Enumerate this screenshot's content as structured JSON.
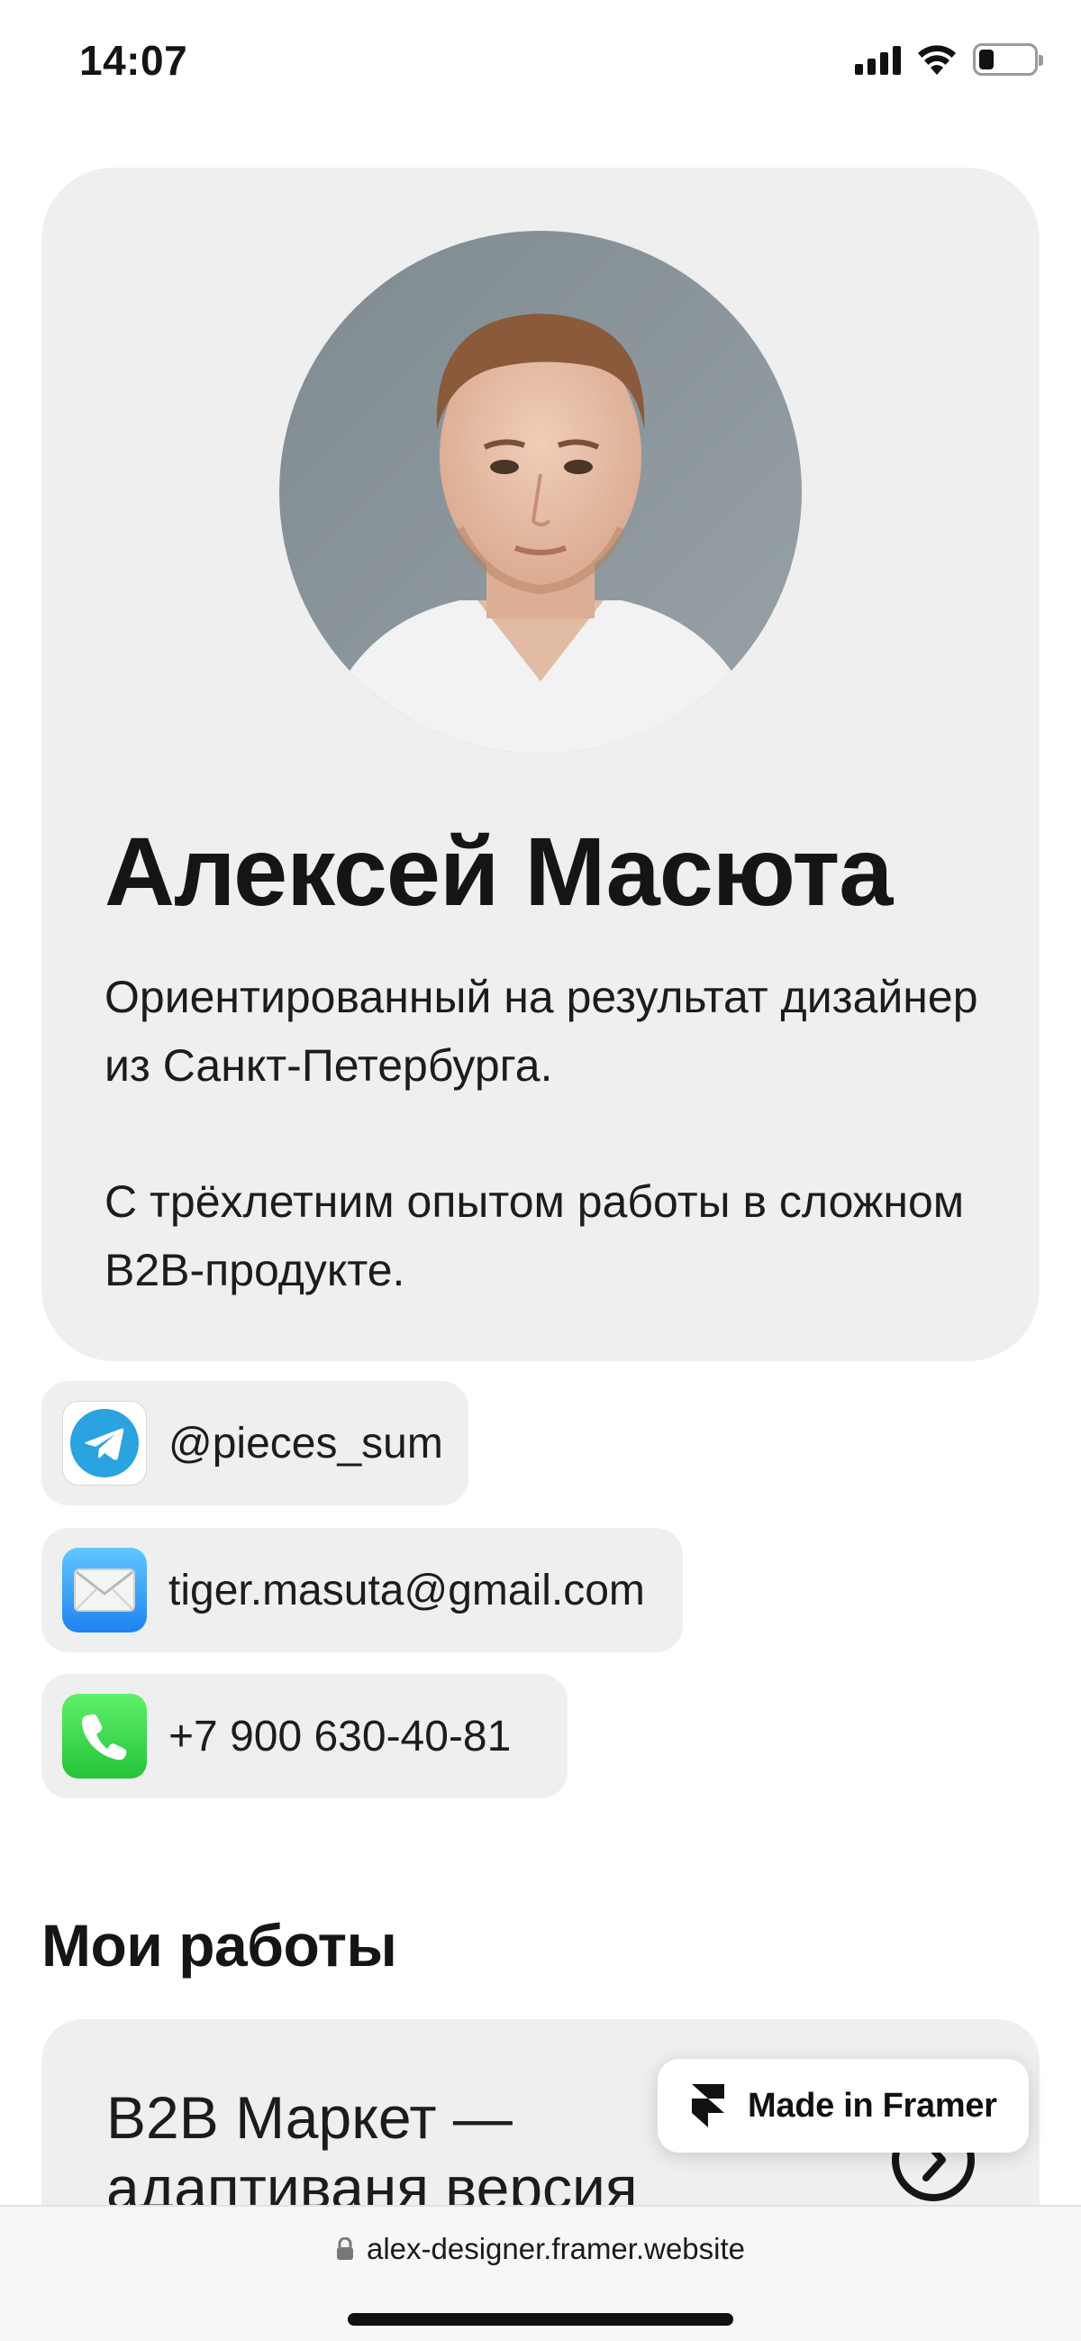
{
  "status_bar": {
    "time": "14:07",
    "icons": [
      "signal-icon",
      "wifi-icon",
      "battery-icon"
    ]
  },
  "profile": {
    "name": "Алексей Масюта",
    "bio_1": "Ориентированный на результат дизайнер из Санкт-Петербурга.",
    "bio_2": "С трёхлетним опытом работы в сложном B2B-продукте."
  },
  "contacts": {
    "telegram": {
      "icon": "telegram-icon",
      "label": "@pieces_sum"
    },
    "email": {
      "icon": "mail-icon",
      "label": "tiger.masuta@gmail.com"
    },
    "phone": {
      "icon": "phone-icon",
      "label": "+7 900 630-40-81"
    }
  },
  "works": {
    "title": "Мои работы",
    "items": [
      {
        "title": "B2B Маркет — адаптиваня версия",
        "icon": "arrow-right-circle-icon"
      }
    ]
  },
  "framer_badge": {
    "label": "Made in Framer",
    "icon": "framer-logo-icon"
  },
  "browser": {
    "url": "alex-designer.framer.website",
    "icon": "lock-icon"
  },
  "colors": {
    "card_bg": "#efefef",
    "telegram_blue": "#2aa3e0",
    "mail_blue": "#1e83f0",
    "phone_green": "#28c840"
  }
}
